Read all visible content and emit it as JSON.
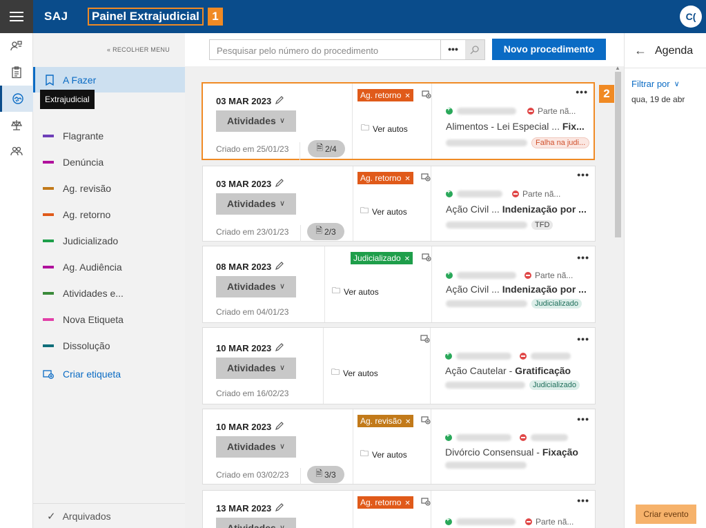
{
  "header": {
    "brand": "SAJ",
    "title": "Painel Extrajudicial",
    "marker_1": "1",
    "marker_2": "2",
    "avatar": "C("
  },
  "rail": {
    "items": [
      "user-search-icon",
      "clipboard-icon",
      "handshake-icon",
      "scales-icon",
      "people-icon"
    ],
    "active": "handshake-icon",
    "tooltip": "Extrajudicial"
  },
  "sidemenu": {
    "collapse_label": "RECOLHER MENU",
    "todo_label": "A Fazer",
    "labels": [
      {
        "name": "Flagrante",
        "color": "#6e3fb8"
      },
      {
        "name": "Denúncia",
        "color": "#b0119c"
      },
      {
        "name": "Ag. revisão",
        "color": "#c27a1a"
      },
      {
        "name": "Ag. retorno",
        "color": "#e05a1a"
      },
      {
        "name": "Judicializado",
        "color": "#1e9e4a"
      },
      {
        "name": "Ag. Audiência",
        "color": "#b0119c"
      },
      {
        "name": "Atividades e...",
        "color": "#3a8a3a"
      },
      {
        "name": "Nova Etiqueta",
        "color": "#e23fa8"
      },
      {
        "name": "Dissolução",
        "color": "#106e7a"
      }
    ],
    "create_label": "Criar etiqueta",
    "archived_label": "Arquivados"
  },
  "search": {
    "placeholder": "Pesquisar pelo número do procedimento",
    "options_label": "•••",
    "new_button": "Novo procedimento"
  },
  "cards": [
    {
      "date": "03 MAR 2023",
      "activities": "Atividades",
      "created": "Criado em 25/01/23",
      "pages": "2/4",
      "tag": "Ag. retorno",
      "tag_color": "#e05a1a",
      "autos": "Ver autos",
      "party": "Parte nã...",
      "subject": "Alimentos - Lei Especial ...",
      "subject_bold": "Fix...",
      "badge": "Falha na judi...",
      "badge_style": "fail"
    },
    {
      "date": "03 MAR 2023",
      "activities": "Atividades",
      "created": "Criado em 23/01/23",
      "pages": "2/3",
      "tag": "Ag. retorno",
      "tag_color": "#e05a1a",
      "autos": "Ver autos",
      "party": "Parte nã...",
      "subject": "Ação Civil ...",
      "subject_bold": "Indenização por ...",
      "badge": "TFD",
      "badge_style": "grey"
    },
    {
      "date": "08 MAR 2023",
      "activities": "Atividades",
      "created": "Criado em 04/01/23",
      "pages": "",
      "tag": "Judicializado",
      "tag_color": "#1e9e4a",
      "autos": "Ver autos",
      "party": "Parte nã...",
      "subject": "Ação Civil ...",
      "subject_bold": "Indenização por ...",
      "badge": "Judicializado",
      "badge_style": "teal"
    },
    {
      "date": "10 MAR 2023",
      "activities": "Atividades",
      "created": "Criado em 16/02/23",
      "pages": "",
      "tag": "",
      "tag_color": "",
      "autos": "Ver autos",
      "party": "",
      "subject": "Ação Cautelar - ",
      "subject_bold": "Gratificação",
      "badge": "Judicializado",
      "badge_style": "teal"
    },
    {
      "date": "10 MAR 2023",
      "activities": "Atividades",
      "created": "Criado em 03/02/23",
      "pages": "3/3",
      "tag": "Ag. revisão",
      "tag_color": "#c27a1a",
      "autos": "Ver autos",
      "party": "",
      "subject": "Divórcio Consensual - ",
      "subject_bold": "Fixação",
      "badge": "",
      "badge_style": ""
    },
    {
      "date": "13 MAR 2023",
      "activities": "Atividades",
      "created": "",
      "pages": "",
      "tag": "Ag. retorno",
      "tag_color": "#e05a1a",
      "autos": "",
      "party": "Parte nã...",
      "subject": "",
      "subject_bold": "",
      "badge": "",
      "badge_style": ""
    }
  ],
  "agenda": {
    "title": "Agenda",
    "filter_label": "Filtrar por",
    "date": "qua, 19 de abr",
    "create_event": "Criar evento"
  }
}
